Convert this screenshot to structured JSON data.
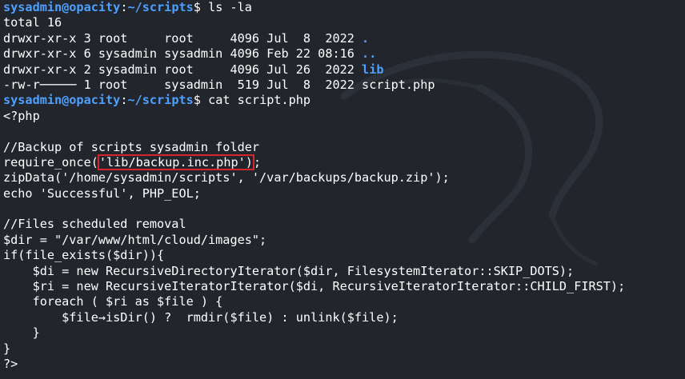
{
  "colors": {
    "background": "#22252c",
    "prompt": "#4ea0ff",
    "text": "#ffffff",
    "highlight_box": "#d4262b"
  },
  "prompt": {
    "user_host": "sysadmin@opacity",
    "separator": ":",
    "path": "~/scripts",
    "dollar": "$"
  },
  "commands": {
    "ls": " ls -la",
    "cat": " cat script.php"
  },
  "ls_output": {
    "total": "total 16",
    "rows": [
      {
        "meta": "drwxr-xr-x 3 root     root     4096 Jul  8  2022 ",
        "name": ".",
        "is_dir": true
      },
      {
        "meta": "drwxr-xr-x 6 sysadmin sysadmin 4096 Feb 22 08:16 ",
        "name": "..",
        "is_dir": true
      },
      {
        "meta": "drwxr-xr-x 2 sysadmin root     4096 Jul 26  2022 ",
        "name": "lib",
        "is_dir": true
      },
      {
        "meta": "-rw-r───── 1 root     sysadmin  519 Jul  8  2022 ",
        "name": "script.php",
        "is_dir": false
      }
    ]
  },
  "php": {
    "open_tag": "<?php",
    "comment_backup": "//Backup of scripts sysadmin folder",
    "require_prefix": "require_once(",
    "require_arg": "'lib/backup.inc.php')",
    "require_suffix": ";",
    "zip_line": "zipData('/home/sysadmin/scripts', '/var/backups/backup.zip');",
    "echo_line": "echo 'Successful', PHP_EOL;",
    "comment_removal": "//Files scheduled removal",
    "dir_line": "$dir = \"/var/www/html/cloud/images\";",
    "if_line": "if(file_exists($dir)){",
    "di_line": "    $di = new RecursiveDirectoryIterator($dir, FilesystemIterator::SKIP_DOTS);",
    "ri_line": "    $ri = new RecursiveIteratorIterator($di, RecursiveIteratorIterator::CHILD_FIRST);",
    "foreach_line": "    foreach ( $ri as $file ) {",
    "isdir_line": "        $file→isDir() ?  rmdir($file) : unlink($file);",
    "close_inner": "    }",
    "close_outer": "}",
    "close_tag": "?>"
  }
}
